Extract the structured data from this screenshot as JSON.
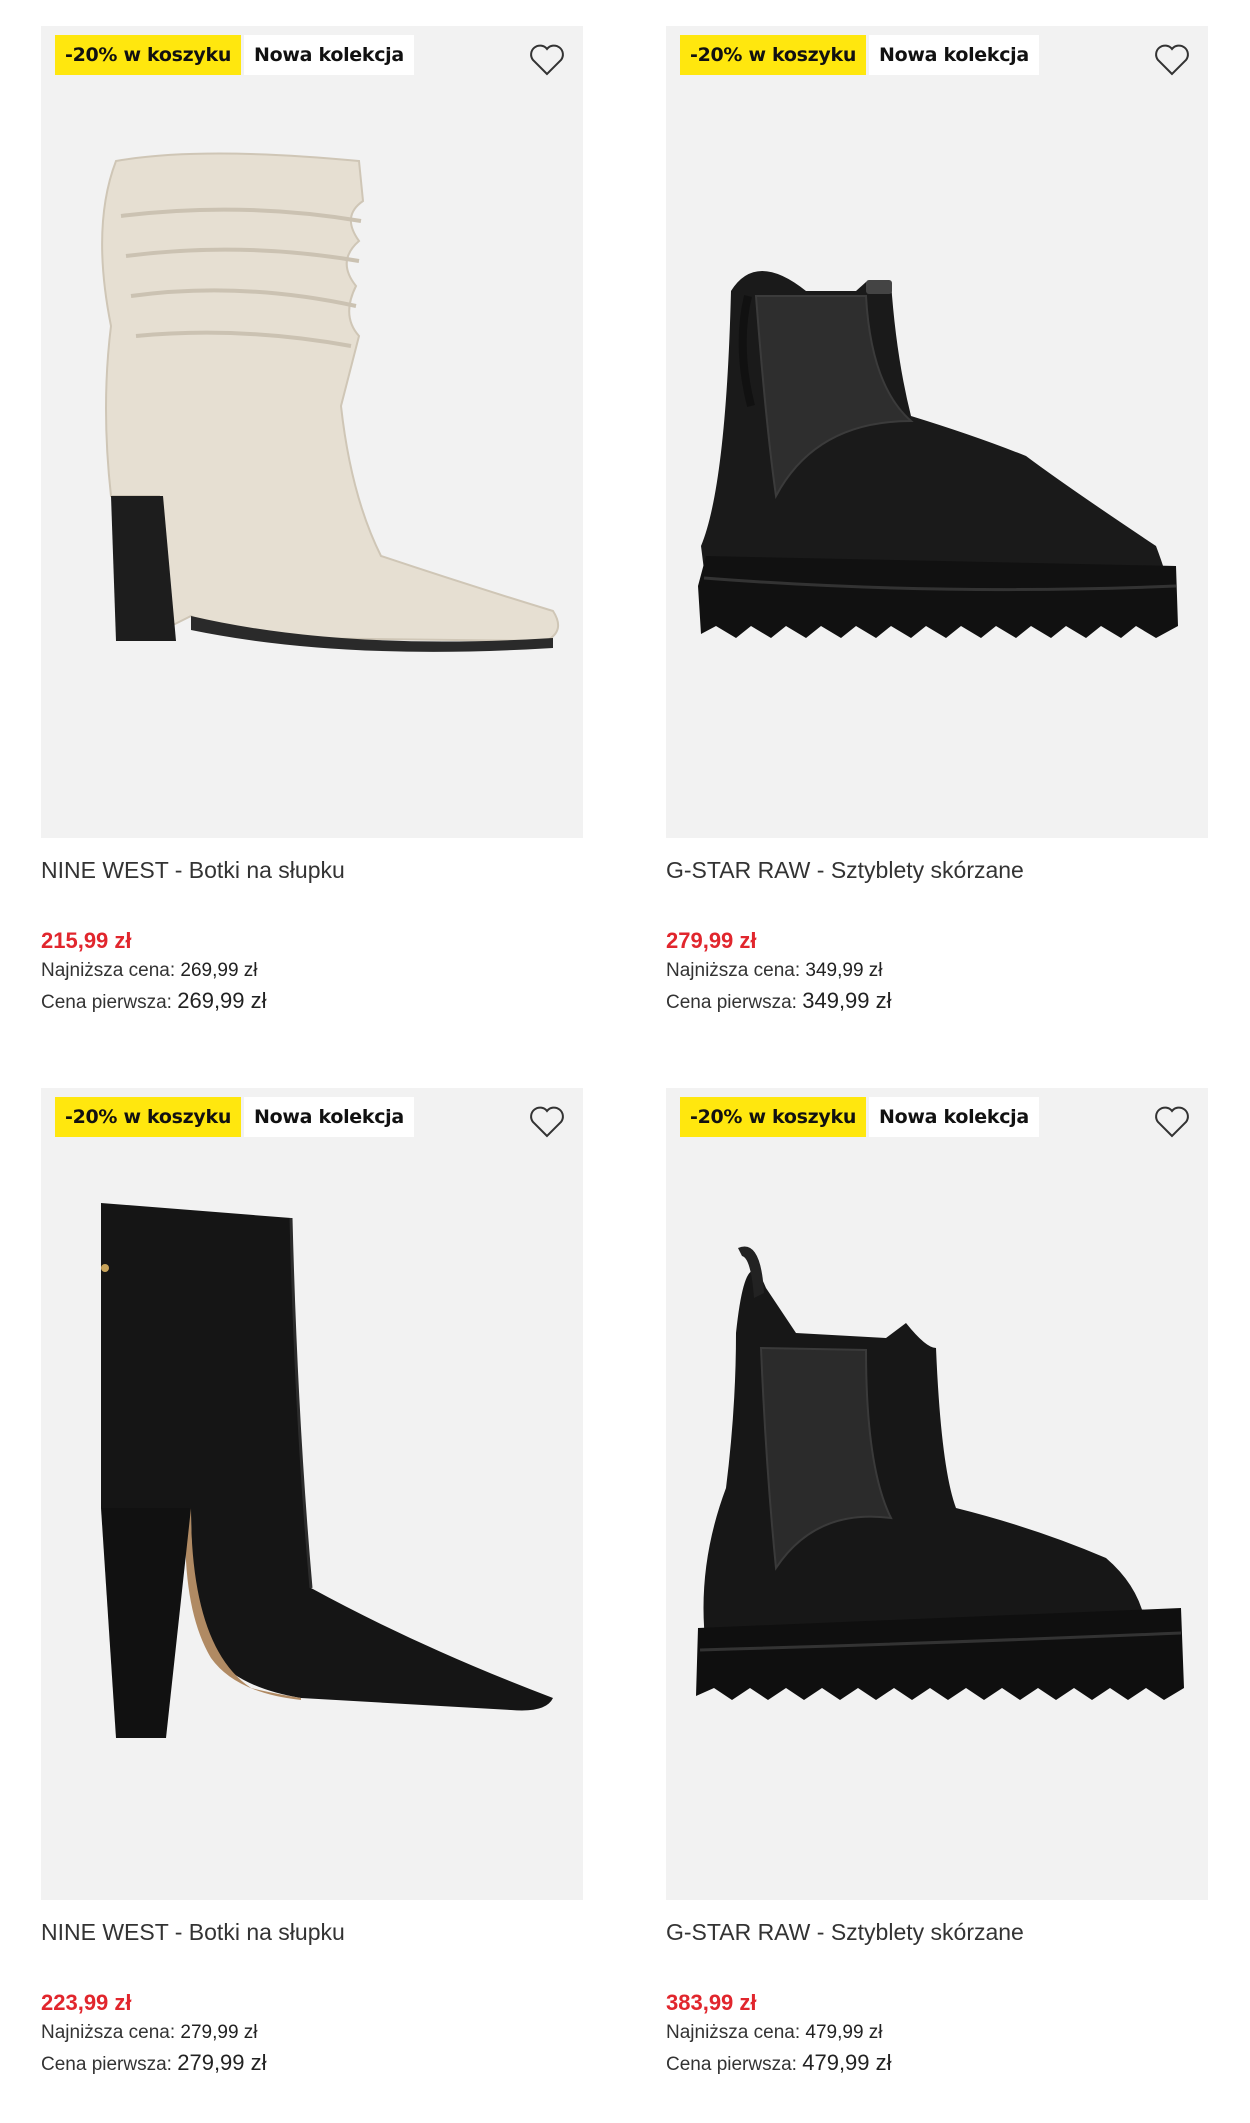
{
  "products": [
    {
      "badge_promo": "-20% w koszyku",
      "badge_new": "Nowa kolekcja",
      "image_alt": "beige slouch heeled ankle boot",
      "title": "NINE WEST - Botki na słupku",
      "price": "215,99 zł",
      "lowest_label": "Najniższa cena:",
      "lowest_value": "269,99 zł",
      "first_label": "Cena pierwsza:",
      "first_value": "269,99 zł"
    },
    {
      "badge_promo": "-20% w koszyku",
      "badge_new": "Nowa kolekcja",
      "image_alt": "black leather chelsea boot with lug sole",
      "title": "G-STAR RAW - Sztyblety skórzane",
      "price": "279,99 zł",
      "lowest_label": "Najniższa cena:",
      "lowest_value": "349,99 zł",
      "first_label": "Cena pierwsza:",
      "first_value": "349,99 zł"
    },
    {
      "badge_promo": "-20% w koszyku",
      "badge_new": "Nowa kolekcja",
      "image_alt": "black pointed heeled ankle boot",
      "title": "NINE WEST - Botki na słupku",
      "price": "223,99 zł",
      "lowest_label": "Najniższa cena:",
      "lowest_value": "279,99 zł",
      "first_label": "Cena pierwsza:",
      "first_value": "279,99 zł"
    },
    {
      "badge_promo": "-20% w koszyku",
      "badge_new": "Nowa kolekcja",
      "image_alt": "black leather chelsea boot with chunky sole",
      "title": "G-STAR RAW - Sztyblety skórzane",
      "price": "383,99 zł",
      "lowest_label": "Najniższa cena:",
      "lowest_value": "479,99 zł",
      "first_label": "Cena pierwsza:",
      "first_value": "479,99 zł"
    }
  ],
  "icons": {
    "wishlist": "heart-outline-icon"
  },
  "colors": {
    "promo_badge": "#ffe70e",
    "sale_price": "#e1262d",
    "image_bg": "#f2f2f2"
  }
}
